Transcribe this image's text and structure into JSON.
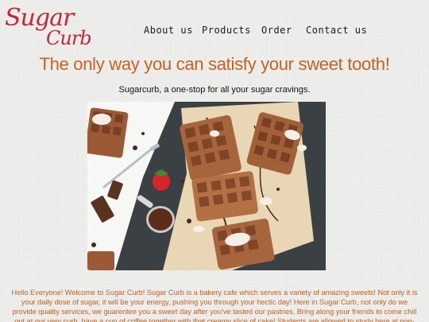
{
  "brand": {
    "name_line1": "Sugar",
    "name_line2": "Curb"
  },
  "nav": {
    "items": [
      {
        "label": "About us"
      },
      {
        "label": "Products"
      },
      {
        "label": "Order"
      },
      {
        "label": "Contact us"
      }
    ]
  },
  "hero": {
    "headline": "The only way you can satisfy your sweet tooth!",
    "tagline": "Sugarcurb, a one-stop for all your sugar cravings."
  },
  "intro": {
    "text": "Hello Everyone! Welcome to Sugar Curb! Sugar Curb is a bakery cafe which serves a variety of amazing sweets! Not only it is your daily dose of sugar, it will be your energy, pushing you through your hectic day! Here in Sugar Curb, not only do we provide quality services, we guarentee you a sweet day after you've tasted our pastries. Bring along your friends to come chill out at our very curb, have a cup of coffee together with that creamy slice of cake! Students are allowed to study here at non-peak period and the drinks that we provide are refillable! What are you waiting"
  },
  "colors": {
    "brand_red": "#c8263a",
    "accent_orange": "#c8621f",
    "slate": "#3a3f44",
    "parchment": "#e9d6b4"
  }
}
